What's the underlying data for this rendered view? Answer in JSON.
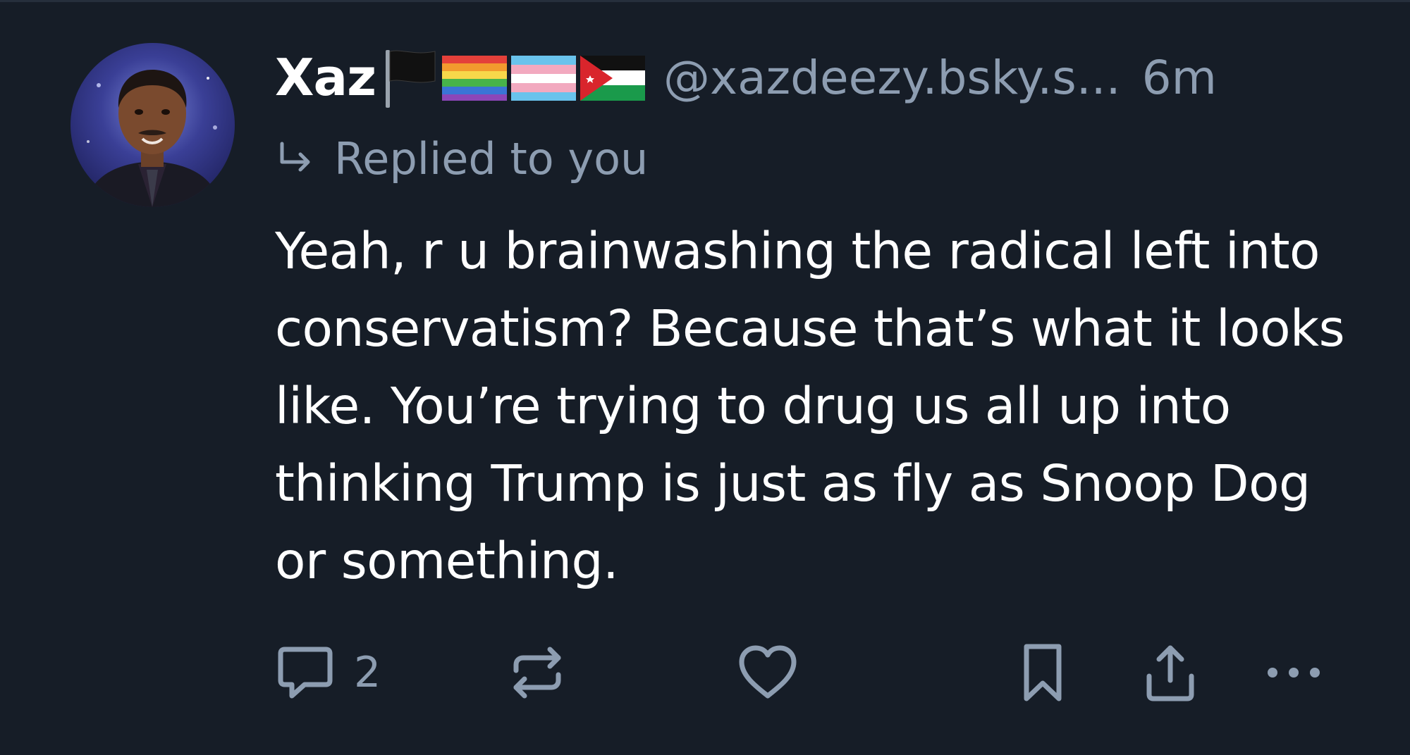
{
  "post": {
    "author": {
      "display_name": "Xaz",
      "handle": "@xazdeezy.bsky.s...",
      "flags": [
        "black-flag-icon",
        "rainbow-flag-icon",
        "transgender-flag-icon",
        "jordan-flag-icon"
      ]
    },
    "timestamp": "6m",
    "reply_context": "Replied to you",
    "text": "Yeah, r u brainwashing the radical left into conservatism? Because that’s what it looks like. You’re trying to drug us all up into thinking Trump is just as fly as Snoop Dog or something.",
    "actions": {
      "reply_count": "2",
      "icons": [
        "reply-icon",
        "repost-icon",
        "like-icon",
        "bookmark-icon",
        "share-icon",
        "more-icon"
      ]
    }
  },
  "colors": {
    "background": "#161d27",
    "muted_text": "#8d9db1",
    "primary_text": "#ffffff"
  }
}
